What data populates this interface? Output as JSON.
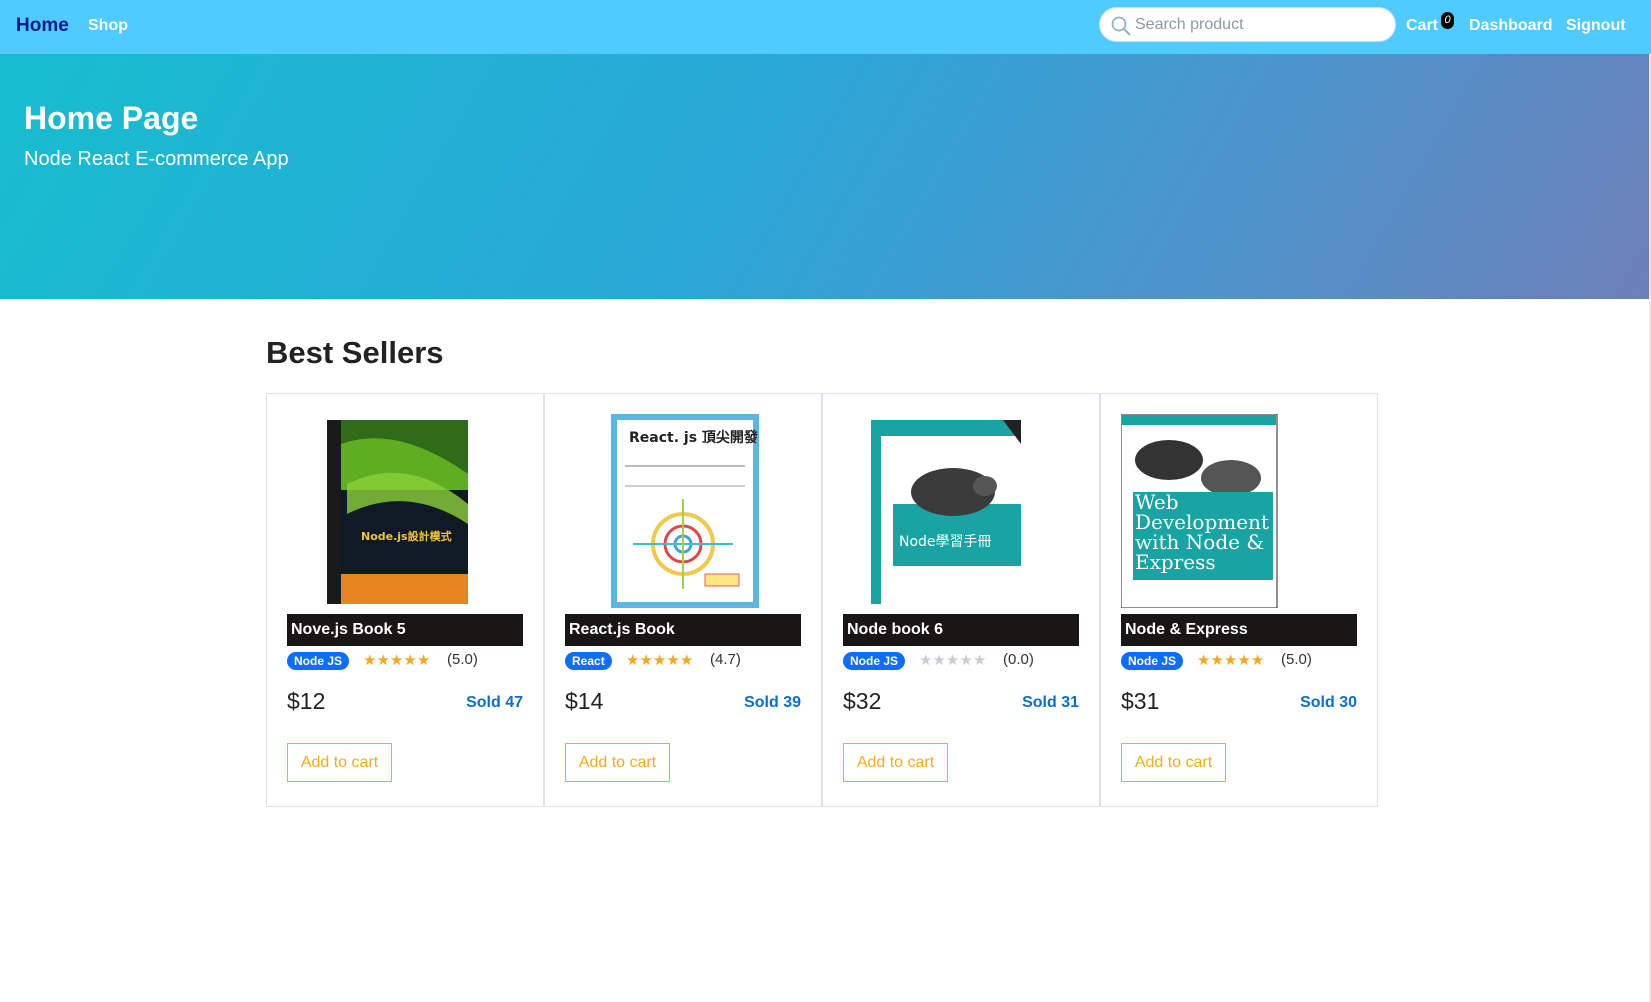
{
  "nav": {
    "home": "Home",
    "shop": "Shop",
    "search_placeholder": "Search product",
    "cart": "Cart",
    "cart_count": "0",
    "dashboard": "Dashboard",
    "signout": "Signout"
  },
  "hero": {
    "title": "Home Page",
    "subtitle": "Node React E-commerce App"
  },
  "section": {
    "title": "Best Sellers"
  },
  "products": [
    {
      "title": "Nove.js Book 5",
      "category": "Node JS",
      "rating": "(5.0)",
      "stars": 5,
      "price": "$12",
      "sold": "Sold 47",
      "cta": "Add to cart",
      "cover_text": "Node.js設計模式"
    },
    {
      "title": "React.js Book",
      "category": "React",
      "rating": "(4.7)",
      "stars": 4.7,
      "price": "$14",
      "sold": "Sold 39",
      "cta": "Add to cart",
      "cover_text": "React. js 頂尖開發"
    },
    {
      "title": "Node book 6",
      "category": "Node JS",
      "rating": "(0.0)",
      "stars": 0,
      "price": "$32",
      "sold": "Sold 31",
      "cta": "Add to cart",
      "cover_text": "Node學習手冊"
    },
    {
      "title": "Node & Express",
      "category": "Node JS",
      "rating": "(5.0)",
      "stars": 5,
      "price": "$31",
      "sold": "Sold 30",
      "cta": "Add to cart",
      "cover_text": "Web Development with Node & Express"
    }
  ],
  "colors": {
    "navbar": "#4fcbff",
    "hero_start": "#17bdcf",
    "hero_end": "#6d7fb8",
    "star_filled": "#f5a623",
    "star_empty": "#c7ccd6",
    "category_badge": "#0d6efd",
    "cta": "#f0ad1c"
  }
}
